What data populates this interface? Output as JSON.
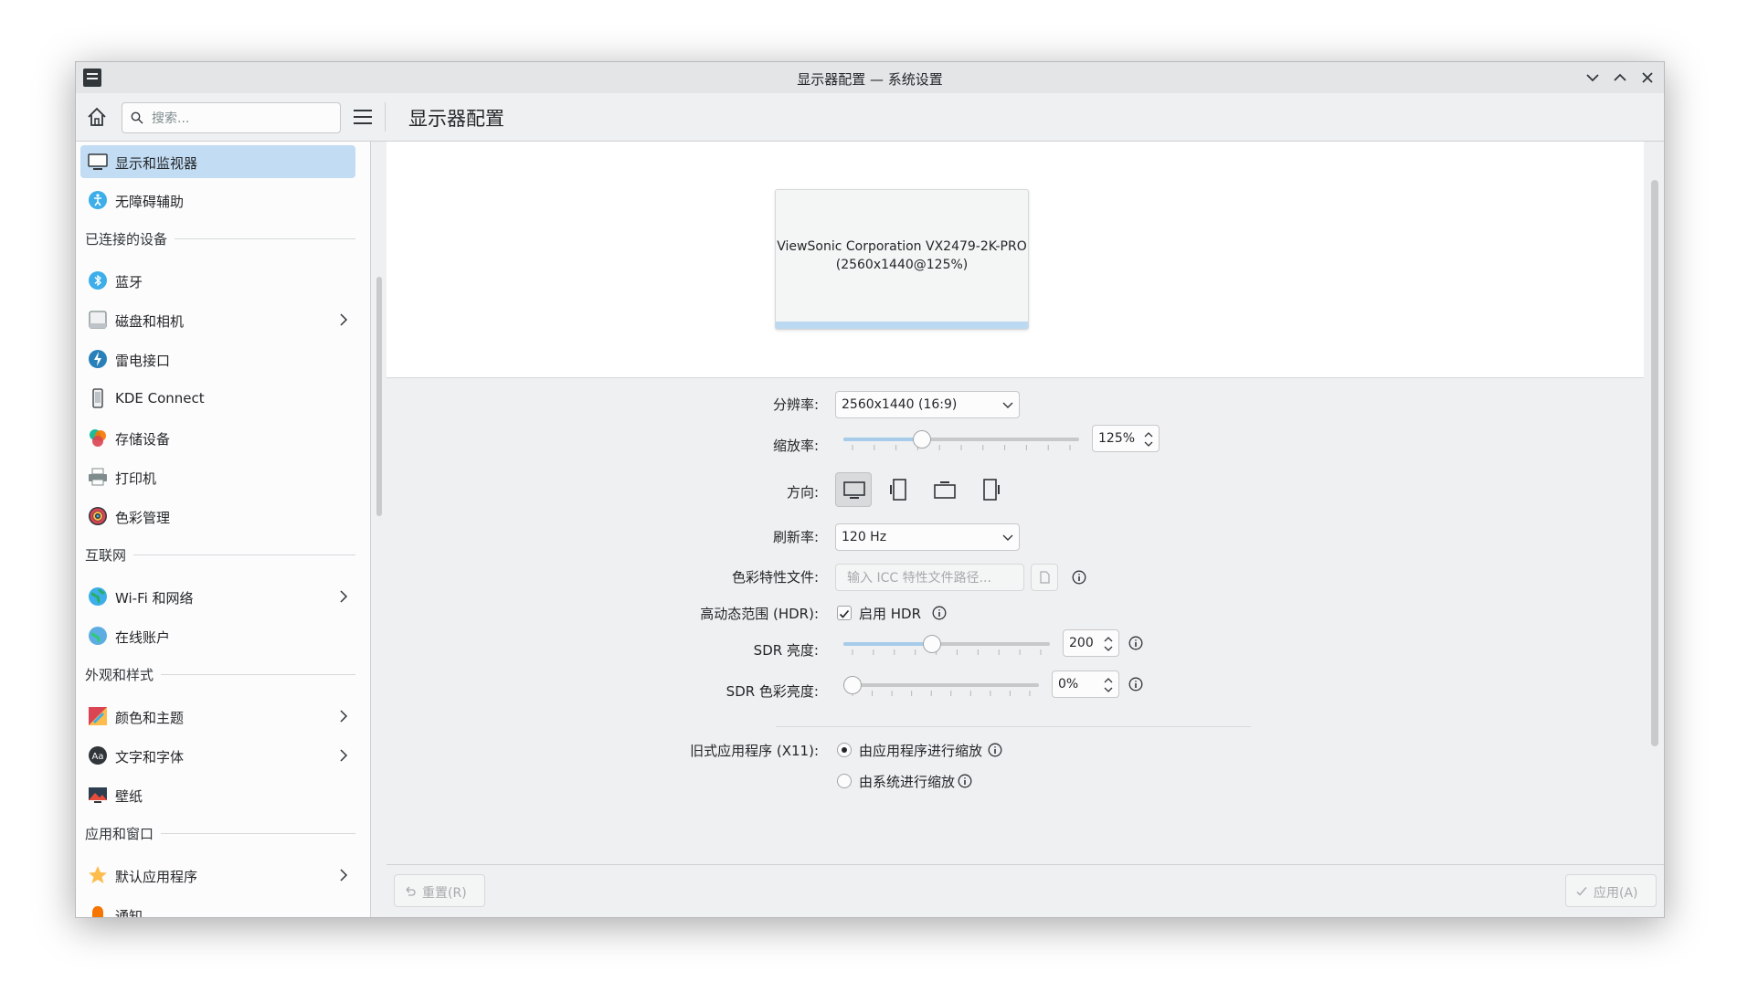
{
  "window": {
    "title": "显示器配置 — 系统设置"
  },
  "header": {
    "search_placeholder": "搜索...",
    "page_title": "显示器配置"
  },
  "sidebar": {
    "items": [
      {
        "label": "显示和监视器",
        "icon": "monitor-icon",
        "active": true
      },
      {
        "label": "无障碍辅助",
        "icon": "accessibility-icon"
      },
      {
        "label": "蓝牙",
        "icon": "bluetooth-icon"
      },
      {
        "label": "磁盘和相机",
        "icon": "disk-icon",
        "chevron": true
      },
      {
        "label": "雷电接口",
        "icon": "thunderbolt-icon"
      },
      {
        "label": "KDE Connect",
        "icon": "phone-icon"
      },
      {
        "label": "存储设备",
        "icon": "storage-icon"
      },
      {
        "label": "打印机",
        "icon": "printer-icon"
      },
      {
        "label": "色彩管理",
        "icon": "color-wheel-icon"
      },
      {
        "label": "Wi-Fi 和网络",
        "icon": "globe-icon",
        "chevron": true
      },
      {
        "label": "在线账户",
        "icon": "online-accounts-icon"
      },
      {
        "label": "颜色和主题",
        "icon": "theme-icon",
        "chevron": true
      },
      {
        "label": "文字和字体",
        "icon": "font-icon",
        "chevron": true
      },
      {
        "label": "壁纸",
        "icon": "wallpaper-icon"
      },
      {
        "label": "默认应用程序",
        "icon": "star-icon",
        "chevron": true
      },
      {
        "label": "通知",
        "icon": "bell-icon"
      }
    ],
    "sections": [
      "已连接的设备",
      "互联网",
      "外观和样式",
      "应用和窗口"
    ]
  },
  "preview": {
    "monitor_name": "ViewSonic Corporation VX2479-2K-PRO",
    "monitor_mode": "(2560x1440@125%)"
  },
  "form": {
    "resolution_label": "分辨率:",
    "resolution_value": "2560x1440 (16:9)",
    "scale_label": "缩放率:",
    "scale_value": "125%",
    "scale_fraction": 0.32,
    "orientation_label": "方向:",
    "refresh_label": "刷新率:",
    "refresh_value": "120 Hz",
    "icc_label": "色彩特性文件:",
    "icc_placeholder": "输入 ICC 特性文件路径...",
    "hdr_label": "高动态范围 (HDR):",
    "hdr_checkbox": "启用 HDR",
    "sdr_brightness_label": "SDR 亮度:",
    "sdr_brightness_value": "200",
    "sdr_brightness_fraction": 0.42,
    "sdr_color_label": "SDR 色彩亮度:",
    "sdr_color_value": "0%",
    "sdr_color_fraction": 0.0,
    "legacy_label": "旧式应用程序 (X11):",
    "legacy_option1": "由应用程序进行缩放",
    "legacy_option2": "由系统进行缩放"
  },
  "footer": {
    "reset_label": "重置(R)",
    "apply_label": "应用(A)"
  },
  "colors": {
    "accent": "#3daee9",
    "selection": "#c2dcf3"
  }
}
